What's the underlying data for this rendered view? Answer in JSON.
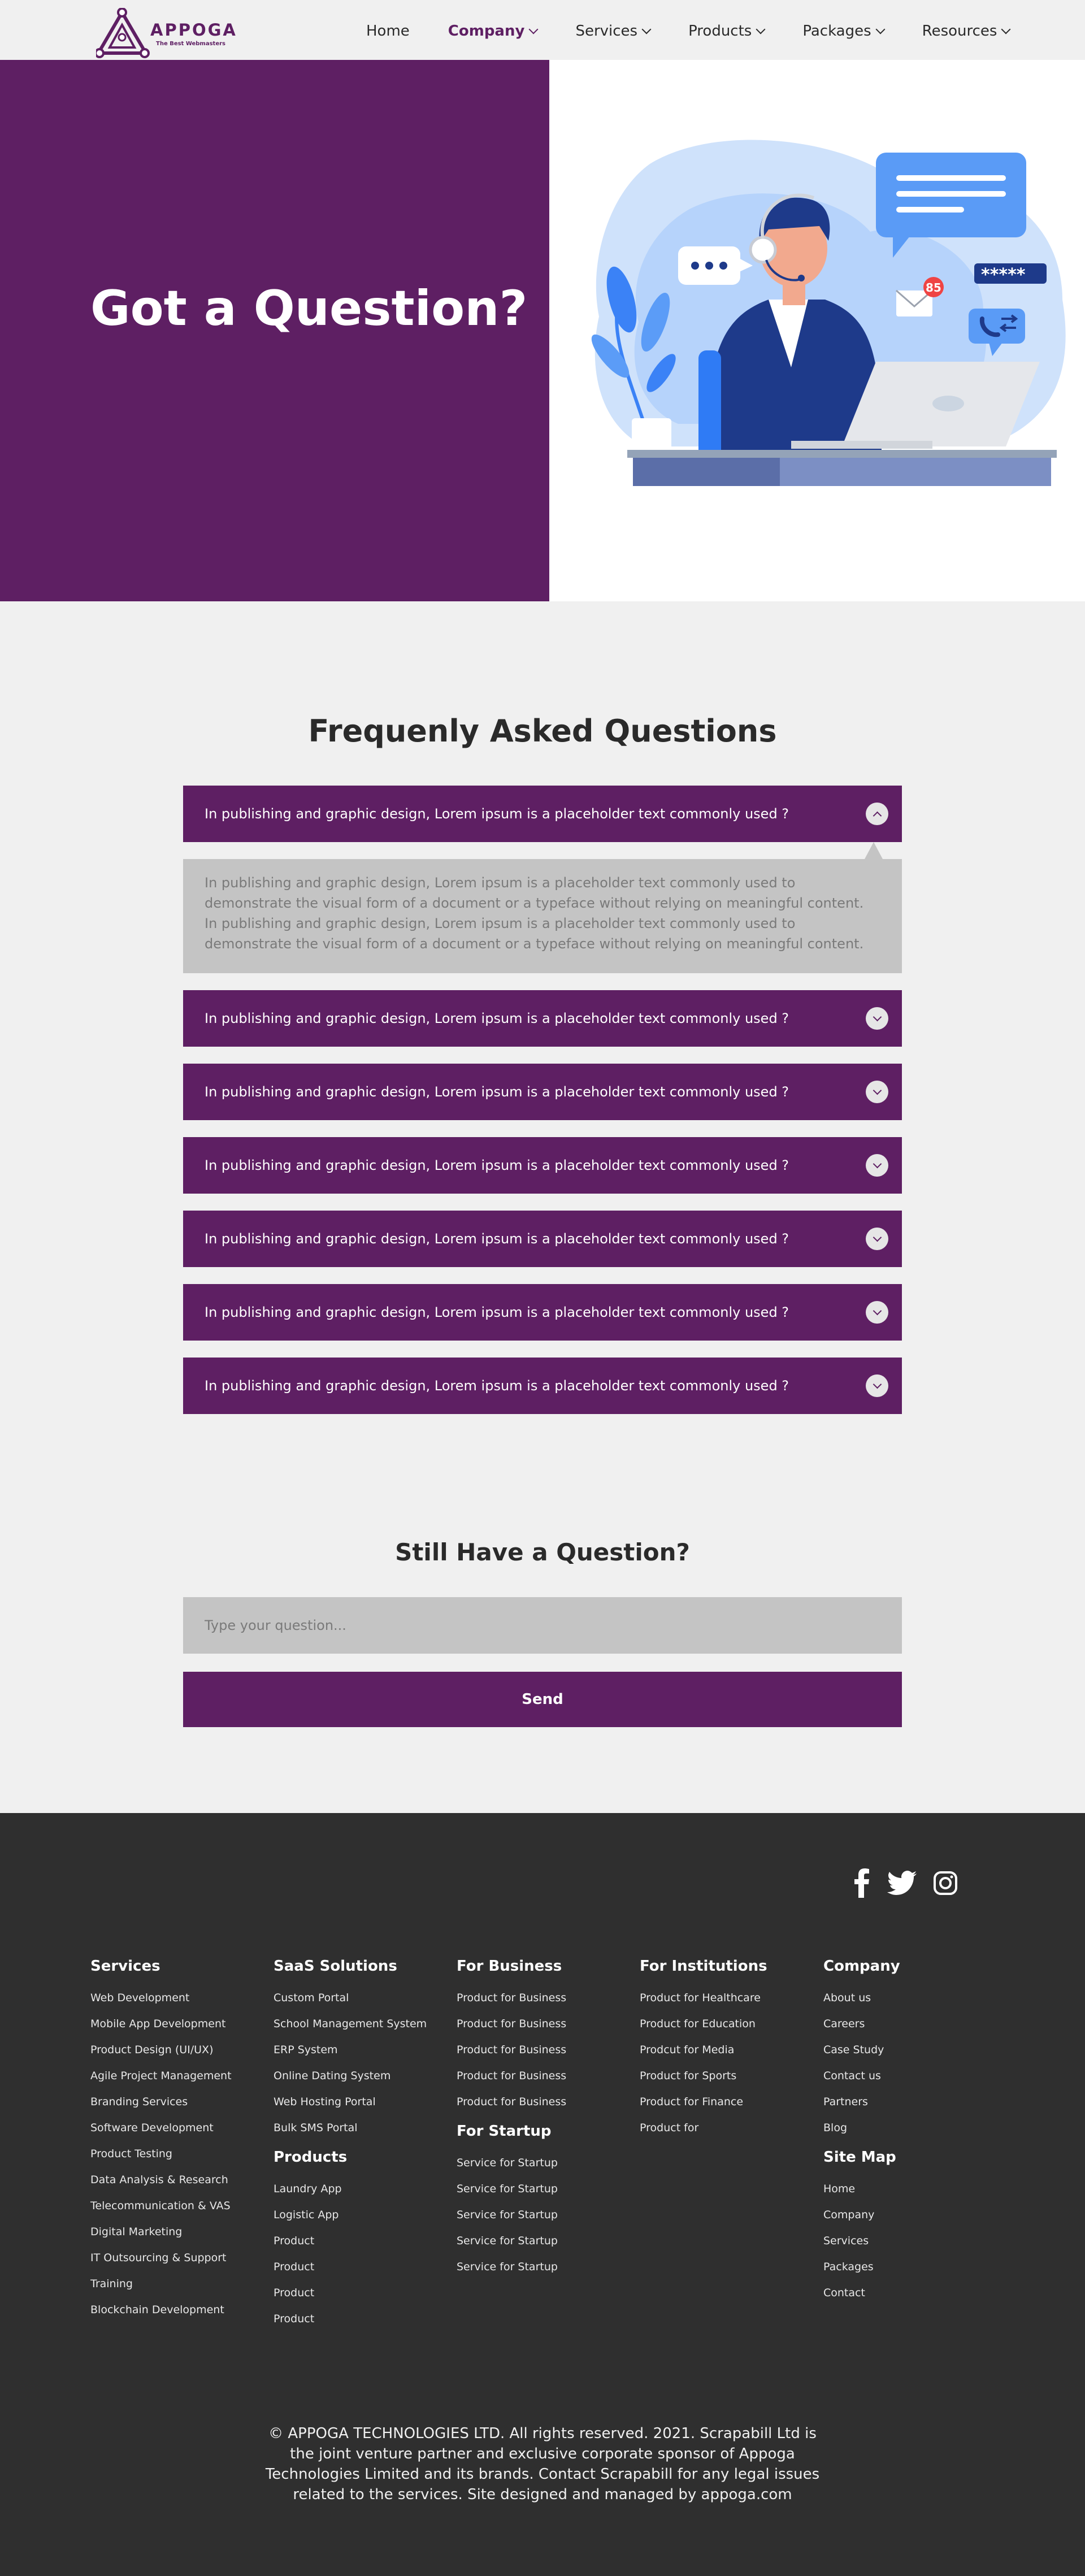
{
  "brand": {
    "name": "APPOGA",
    "tagline": "The Best Webmasters",
    "accent_color": "#5e1f63"
  },
  "nav": {
    "items": [
      {
        "label": "Home",
        "has_dropdown": false,
        "active": false
      },
      {
        "label": "Company",
        "has_dropdown": true,
        "active": true
      },
      {
        "label": "Services",
        "has_dropdown": true,
        "active": false
      },
      {
        "label": "Products",
        "has_dropdown": true,
        "active": false
      },
      {
        "label": "Packages",
        "has_dropdown": true,
        "active": false
      },
      {
        "label": "Resources",
        "has_dropdown": true,
        "active": false
      }
    ]
  },
  "hero": {
    "title": "Got a Question?",
    "illustration": {
      "icon": "customer-support-illustration",
      "badge_count": "85",
      "password_mask": "*****"
    }
  },
  "faq": {
    "title": "Frequenly Asked Questions",
    "items": [
      {
        "question": "In publishing and graphic design, Lorem ipsum is a placeholder text commonly used ?",
        "expanded": true
      },
      {
        "question": "In publishing and graphic design, Lorem ipsum is a placeholder text commonly used ?",
        "expanded": false
      },
      {
        "question": "In publishing and graphic design, Lorem ipsum is a placeholder text commonly used ?",
        "expanded": false
      },
      {
        "question": "In publishing and graphic design, Lorem ipsum is a placeholder text commonly used ?",
        "expanded": false
      },
      {
        "question": "In publishing and graphic design, Lorem ipsum is a placeholder text commonly used ?",
        "expanded": false
      },
      {
        "question": "In publishing and graphic design, Lorem ipsum is a placeholder text commonly used ?",
        "expanded": false
      },
      {
        "question": "In publishing and graphic design, Lorem ipsum is a placeholder text commonly used ?",
        "expanded": false
      }
    ],
    "answer": "In publishing and graphic design, Lorem ipsum is a placeholder text commonly used to demonstrate the visual form of a document or a typeface without relying on meaningful content. In publishing and graphic design, Lorem ipsum is a placeholder text commonly used to demonstrate the visual form of a document or a typeface without relying on meaningful content."
  },
  "ask": {
    "title": "Still Have a Question?",
    "placeholder": "Type your question...",
    "send_label": "Send"
  },
  "footer": {
    "social": [
      "facebook-icon",
      "twitter-icon",
      "instagram-icon"
    ],
    "columns": [
      {
        "groups": [
          {
            "heading": "Services",
            "links": [
              "Web Development",
              "Mobile App Development",
              "Product Design (UI/UX)",
              "Agile Project Management",
              "Branding Services",
              "Software Development",
              "Product Testing",
              "Data Analysis & Research",
              "Telecommunication & VAS",
              "Digital Marketing",
              "IT Outsourcing & Support",
              "Training",
              "Blockchain Development"
            ]
          }
        ]
      },
      {
        "groups": [
          {
            "heading": "SaaS Solutions",
            "links": [
              "Custom Portal",
              "School Management System",
              "ERP System",
              "Online Dating System",
              "Web Hosting Portal",
              "Bulk SMS Portal"
            ]
          },
          {
            "heading": "Products",
            "links": [
              "Laundry App",
              "Logistic App",
              "Product",
              "Product",
              "Product",
              "Product"
            ]
          }
        ]
      },
      {
        "groups": [
          {
            "heading": "For Business",
            "links": [
              "Product for Business",
              "Product for Business",
              "Product for Business",
              "Product for Business",
              "Product for Business"
            ]
          },
          {
            "heading": "For Startup",
            "links": [
              "Service for Startup",
              "Service for Startup",
              "Service for Startup",
              "Service for Startup",
              "Service for Startup"
            ]
          }
        ]
      },
      {
        "groups": [
          {
            "heading": "For Institutions",
            "links": [
              "Product for Healthcare",
              "Product for Education",
              "Prodcut for Media",
              "Product for Sports",
              "Product for Finance",
              "Product for"
            ]
          }
        ]
      },
      {
        "groups": [
          {
            "heading": "Company",
            "links": [
              "About us",
              "Careers",
              "Case Study",
              "Contact us",
              "Partners",
              "Blog"
            ]
          },
          {
            "heading": "Site Map",
            "links": [
              "Home",
              "Company",
              "Services",
              "Packages",
              "Contact"
            ]
          }
        ]
      }
    ],
    "copyright": "© APPOGA TECHNOLOGIES LTD. All rights reserved. 2021. Scrapabill Ltd is the joint venture partner and exclusive corporate sponsor of Appoga Technologies Limited and its brands. Contact Scrapabill for any legal issues related to the services. Site designed and managed by appoga.com"
  }
}
